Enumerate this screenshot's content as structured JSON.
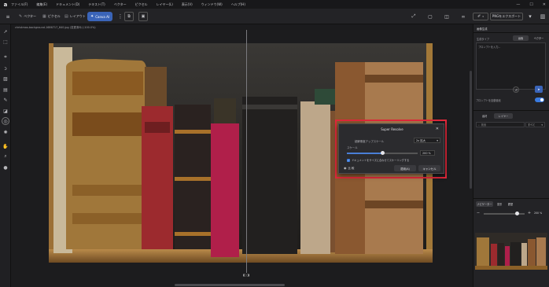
{
  "menubar": {
    "logo": "a",
    "items": [
      "ファイル(F)",
      "編集(E)",
      "ドキュメント(D)",
      "テキスト(T)",
      "ベクター",
      "ピクセル",
      "レイヤー(L)",
      "表示(V)",
      "ウィンドウ(W)",
      "ヘルプ(H)"
    ],
    "window_controls": [
      "—",
      "☐",
      "✕"
    ]
  },
  "toolbar": {
    "modes": [
      {
        "label": "ベクター",
        "icon": "vector-icon"
      },
      {
        "label": "ピクセル",
        "icon": "pixel-icon"
      },
      {
        "label": "レイアウト",
        "icon": "layout-icon"
      },
      {
        "label": "Canva AI",
        "icon": "canva-ai-icon",
        "active": true
      }
    ],
    "export_label": "PNGをエクスポート"
  },
  "document": {
    "tab_title": "christmas-background-1686717_640.jpg (変更済み) (100.0%)"
  },
  "dialog": {
    "title": "Super Resolve",
    "anti_alias_label": "超解像度アップスケール",
    "mode_value": "2x 拡大",
    "scale_label": "スケール",
    "scale_value": "200 %",
    "scale_fraction": 0.5,
    "unit": "%",
    "checkbox_label": "ドキュメントをサイズに合わせてスケーリングする",
    "checkbox_checked": true,
    "preview_label": "比 較",
    "apply_label": "適用(A)",
    "cancel_label": "キャンセル"
  },
  "right_panel": {
    "section1_title": "画像生成",
    "generate_mode_label": "生成タイプ",
    "tab_image": "画像",
    "tab_vector": "ベクター",
    "prompt_placeholder": "プロンプトを入力...",
    "toggle_label": "プロンプトを自動強化",
    "section2_title": "レイヤー",
    "tab_assets": "素材",
    "tab_layers": "レイヤー",
    "search_placeholder": "検索",
    "filter_value": "すべて",
    "nav_tabs": [
      "ナビゲーター",
      "変形",
      "履歴"
    ],
    "zoom_value": "200 %"
  },
  "colors": {
    "accent": "#3a64b8",
    "highlight_border": "#e0283a",
    "panel_bg": "#232326",
    "canvas_bg": "#1c1c1e"
  }
}
